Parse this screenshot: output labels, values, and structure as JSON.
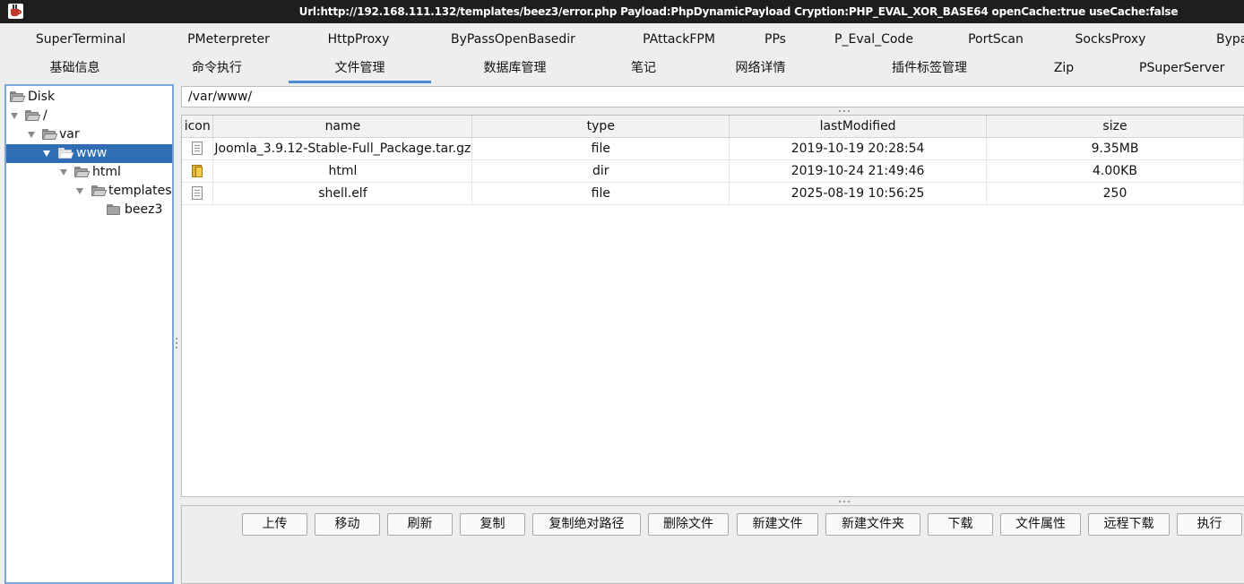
{
  "window": {
    "title": "Url:http://192.168.111.132/templates/beez3/error.php Payload:PhpDynamicPayload Cryption:PHP_EVAL_XOR_BASE64 openCache:true useCache:false",
    "app_icon": "java-cup-icon"
  },
  "plugin_tabs": [
    "SuperTerminal",
    "PMeterpreter",
    "HttpProxy",
    "ByPassOpenBasedir",
    "PAttackFPM",
    "PPs",
    "P_Eval_Code",
    "PortScan",
    "SocksProxy",
    "Bypa"
  ],
  "main_tabs": [
    "基础信息",
    "命令执行",
    "文件管理",
    "数据库管理",
    "笔记",
    "网络详情",
    "插件标签管理",
    "Zip",
    "PSuperServer"
  ],
  "active_main_tab": "文件管理",
  "tree": [
    {
      "label": "Disk",
      "expanded": true,
      "selected": false
    },
    {
      "label": "/",
      "expanded": true,
      "selected": false
    },
    {
      "label": "var",
      "expanded": true,
      "selected": false
    },
    {
      "label": "www",
      "expanded": true,
      "selected": true
    },
    {
      "label": "html",
      "expanded": true,
      "selected": false
    },
    {
      "label": "templates",
      "expanded": true,
      "selected": false
    },
    {
      "label": "beez3",
      "expanded": false,
      "selected": false
    }
  ],
  "path": {
    "value": "/var/www/"
  },
  "file_table": {
    "headers": [
      "icon",
      "name",
      "type",
      "lastModified",
      "size"
    ],
    "rows": [
      {
        "icon": "file-icon",
        "name": "Joomla_3.9.12-Stable-Full_Package.tar.gz",
        "type": "file",
        "lastModified": "2019-10-19 20:28:54",
        "size": "9.35MB"
      },
      {
        "icon": "folder-icon",
        "name": "html",
        "type": "dir",
        "lastModified": "2019-10-24 21:49:46",
        "size": "4.00KB"
      },
      {
        "icon": "file-icon",
        "name": "shell.elf",
        "type": "file",
        "lastModified": "2025-08-19 10:56:25",
        "size": "250"
      }
    ]
  },
  "actions": [
    "上传",
    "移动",
    "刷新",
    "复制",
    "复制绝对路径",
    "删除文件",
    "新建文件",
    "新建文件夹",
    "下载",
    "文件属性",
    "远程下载",
    "执行"
  ],
  "colors": {
    "titlebar": "#1e1e1e",
    "selection": "#2f6db5",
    "active_tab_underline": "#4a8ad4",
    "panel_border": "#7aa6d8"
  }
}
